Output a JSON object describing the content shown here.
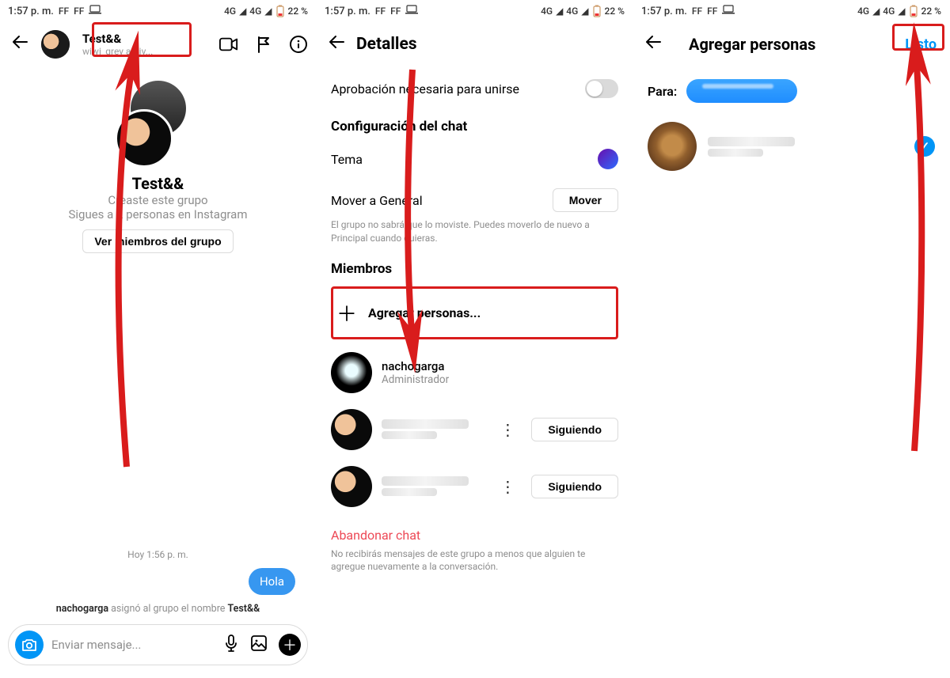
{
  "status": {
    "time": "1:57 p. m.",
    "ff": "FF",
    "net": "4G",
    "battery_pct": "22 %"
  },
  "phone1": {
    "chat_title": "Test&&",
    "chat_sub": "wiwi_grey activ...",
    "group_name": "Test&&",
    "created_line": "Creaste este grupo",
    "follow_line": "Sigues a 2 personas en Instagram",
    "view_members_btn": "Ver miembros del grupo",
    "timestamp": "Hoy 1:56 p. m.",
    "bubble": "Hola",
    "sys_user": "nachogarga",
    "sys_mid": " asignó al grupo el nombre ",
    "sys_name": "Test&&",
    "composer_placeholder": "Enviar mensaje..."
  },
  "phone2": {
    "title": "Detalles",
    "approval_label": "Aprobación necesaria para unirse",
    "config_heading": "Configuración del chat",
    "theme_label": "Tema",
    "move_label": "Mover a General",
    "move_btn": "Mover",
    "move_hint": "El grupo no sabrá que lo moviste. Puedes moverlo de nuevo a Principal cuando quieras.",
    "members_heading": "Miembros",
    "add_people": "Agregar personas...",
    "member1_name": "nachogarga",
    "member1_role": "Administrador",
    "following_btn": "Siguiendo",
    "leave_chat": "Abandonar chat",
    "leave_hint": "No recibirás mensajes de este grupo a menos que alguien te agregue nuevamente a la conversación."
  },
  "phone3": {
    "title": "Agregar personas",
    "done": "Listo",
    "para_label": "Para:"
  }
}
